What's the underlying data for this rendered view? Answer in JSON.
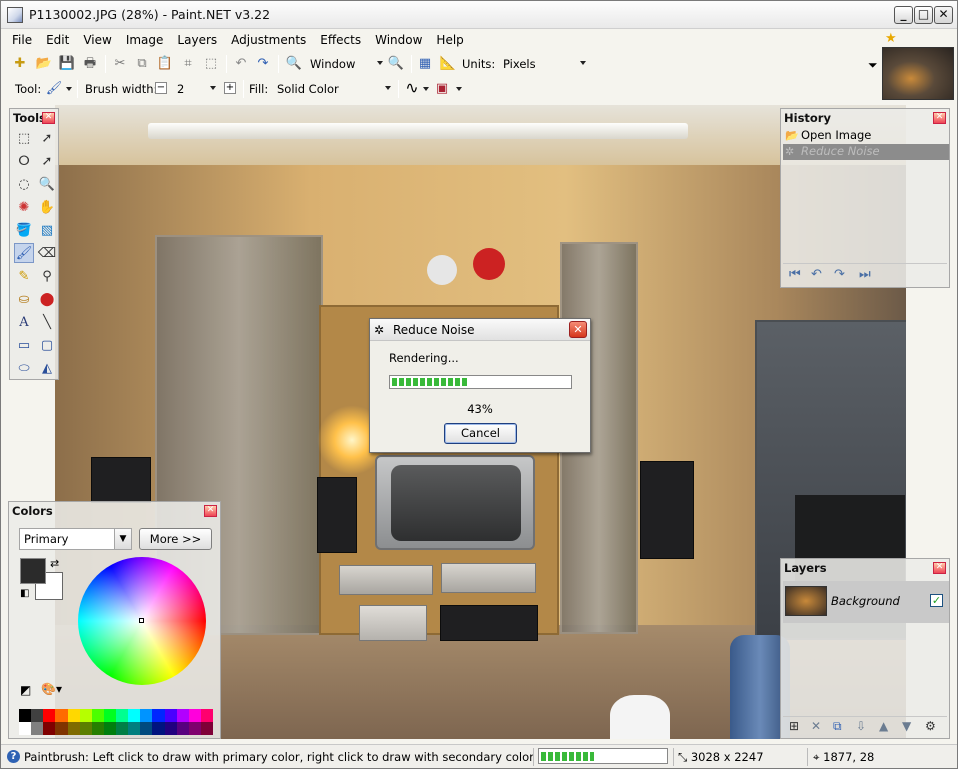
{
  "window": {
    "title": "P1130002.JPG (28%) - Paint.NET v3.22"
  },
  "menu": [
    "File",
    "Edit",
    "View",
    "Image",
    "Layers",
    "Adjustments",
    "Effects",
    "Window",
    "Help"
  ],
  "toolbar1": {
    "zoom_value": "Window",
    "units_label": "Units:",
    "units_value": "Pixels"
  },
  "toolbar2": {
    "tool_label": "Tool:",
    "brush_width_label": "Brush width:",
    "brush_width_value": "2",
    "fill_label": "Fill:",
    "fill_value": "Solid Color"
  },
  "tools_panel": {
    "title": "Tools"
  },
  "history_panel": {
    "title": "History",
    "items": [
      {
        "label": "Open Image"
      },
      {
        "label": "Reduce Noise"
      }
    ]
  },
  "colors_panel": {
    "title": "Colors",
    "mode_value": "Primary",
    "more_label": "More >>",
    "primary_color": "#2b2b2b",
    "secondary_color": "#ffffff"
  },
  "layers_panel": {
    "title": "Layers",
    "layer_name": "Background"
  },
  "dialog": {
    "title": "Reduce Noise",
    "status": "Rendering...",
    "progress": 0.43,
    "progress_text": "43%",
    "cancel_label": "Cancel"
  },
  "statusbar": {
    "hint": "Paintbrush: Left click to draw with primary color, right click to draw with secondary color",
    "progress": 0.43,
    "image_size": "3028 x 2247",
    "cursor_pos": "1877, 28"
  }
}
